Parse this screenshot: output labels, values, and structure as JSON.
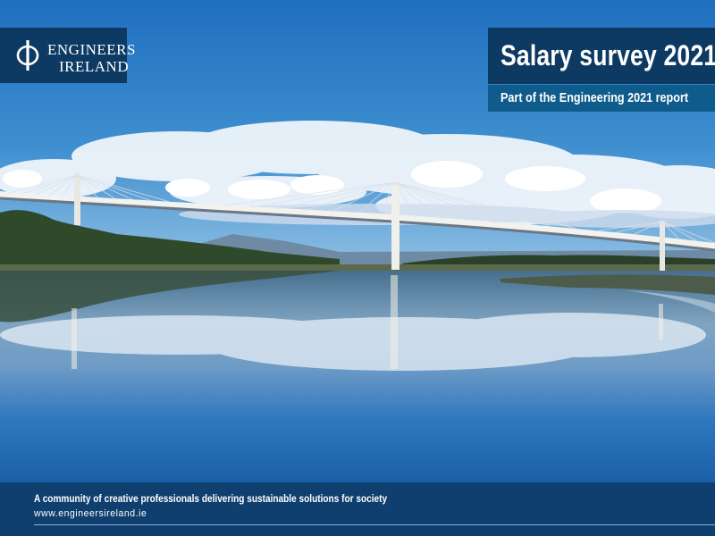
{
  "brand": {
    "name_line1": "ENGINEERS",
    "name_line2": "IRELAND"
  },
  "cover": {
    "title": "Salary survey 2021",
    "subtitle": "Part of the Engineering 2021 report"
  },
  "footer": {
    "tagline": "A community of creative professionals delivering sustainable solutions for society",
    "website": "www.engineersireland.ie"
  },
  "colors": {
    "panel": "#0d3a63",
    "subtitle_panel": "#0f5c8c",
    "footer": "#0f3f6f",
    "sky": "#1f6fb6",
    "water": "#1e6ab0"
  }
}
